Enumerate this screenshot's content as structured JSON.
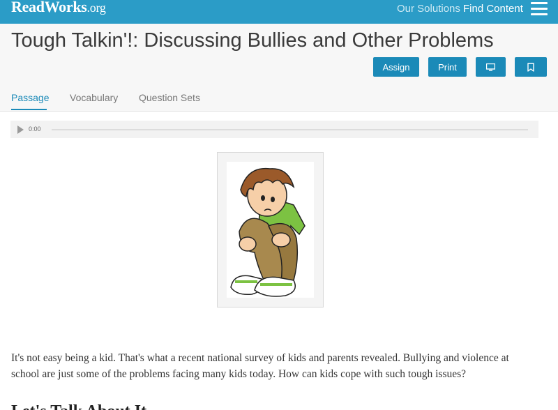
{
  "topbar": {
    "logo_main": "ReadWorks",
    "logo_suffix": ".org",
    "nav": [
      "Our Solutions",
      "Find Content"
    ],
    "menu_icon": "hamburger-icon"
  },
  "header": {
    "title": "Tough Talkin'!: Discussing Bullies and Other Problems",
    "buttons": {
      "assign": "Assign",
      "print": "Print",
      "present_icon": "monitor-icon",
      "save_icon": "bookmark-icon"
    }
  },
  "tabs": [
    "Passage",
    "Vocabulary",
    "Question Sets"
  ],
  "audio": {
    "time": "0:00",
    "play_icon": "play-icon"
  },
  "passage": {
    "text": "It's not easy being a kid. That's what a recent national survey of kids and parents revealed. Bullying and violence at school are just some of the problems facing many kids today. How can kids cope with such tough issues?",
    "subheading": "Let's Talk About It"
  },
  "colors": {
    "brand": "#2b9cc7",
    "button": "#1b8ab8",
    "title": "#3a3a3a"
  }
}
